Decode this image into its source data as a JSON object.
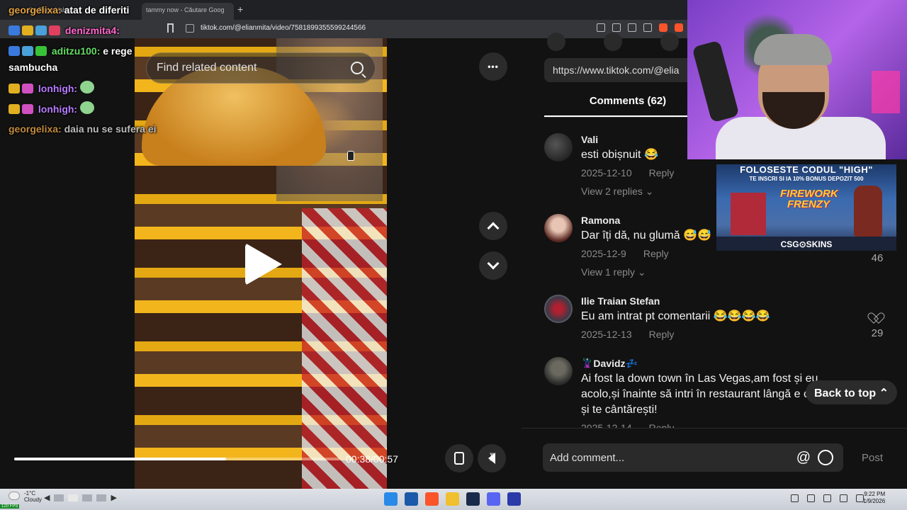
{
  "browser": {
    "tabs": [
      {
        "label": "Cu Rege Vals...",
        "active": false
      },
      {
        "label": "tammy now - Căutare Goog",
        "active": true
      }
    ],
    "new_tab": "+",
    "url": "tiktok.com/@elianmita/video/7581899355599244566"
  },
  "video": {
    "search_placeholder": "Find related content",
    "more_label": "•••",
    "progress_fraction": 0.65,
    "time_label": "00:38/00:57"
  },
  "comments": {
    "share_url": "https://www.tiktok.com/@elia",
    "tab_label": "Comments (62)",
    "items": [
      {
        "user": "Vali",
        "text": "esti obișnuit 😂",
        "date": "2025-12-10",
        "reply": "Reply",
        "view_replies": "View 2 replies",
        "likes": ""
      },
      {
        "user": "Ramona",
        "text": "Dar îți dă, nu glumă 😅😅",
        "date": "2025-12-9",
        "reply": "Reply",
        "view_replies": "View 1 reply",
        "likes": "46"
      },
      {
        "user": "Ilie Traian Stefan",
        "text": "Eu am intrat pt comentarii 😂😂😂😂",
        "date": "2025-12-13",
        "reply": "Reply",
        "view_replies": "",
        "likes": "29"
      },
      {
        "user": "🦹Davidz💤",
        "text": "Ai fost la down town în Las Vegas,am fost și eu acolo,și înainte să intri în restaurant lângă e cântat și te cântărești!",
        "date": "2025-12-14",
        "reply": "Reply",
        "view_replies": "",
        "likes": ""
      }
    ],
    "back_to_top": "Back to top ⌃",
    "add_comment_placeholder": "Add comment...",
    "at_symbol": "@",
    "post_label": "Post"
  },
  "chat": {
    "lines": [
      {
        "user": "georgelixa:",
        "msg": "atat de diferiti",
        "user_color": "#e0a040"
      },
      {
        "user": "denizmita4:",
        "msg": "",
        "user_color": "#ff66cc"
      },
      {
        "user": "aditzu100:",
        "msg": "e rege",
        "user_color": "#66dd66"
      },
      {
        "user": "",
        "msg": "sambucha",
        "user_color": "#ffffff"
      },
      {
        "user": "lonhigh:",
        "msg": "",
        "user_color": "#b77cff"
      },
      {
        "user": "lonhigh:",
        "msg": "",
        "user_color": "#b77cff"
      },
      {
        "user": "georgelixa:",
        "msg": "daia nu se sufera ei",
        "user_color": "#c08a3a"
      }
    ]
  },
  "ad": {
    "top": "FOLOSESTE CODUL \"HIGH\"",
    "sub": "TE INSCRI SI IA 10% BONUS DEPOZIT 500",
    "title": "FIREWORK FRENZY",
    "brand": "CSG⊙SKINS"
  },
  "taskbar": {
    "temp": "-1°C",
    "condition": "Cloudy",
    "time": "9:22 PM",
    "date": "1/9/2026",
    "fps": "120 FPS"
  },
  "colors": {
    "background": "#121212",
    "accent": "#fe2c55",
    "webcam_bg": "#9a4fd6"
  }
}
